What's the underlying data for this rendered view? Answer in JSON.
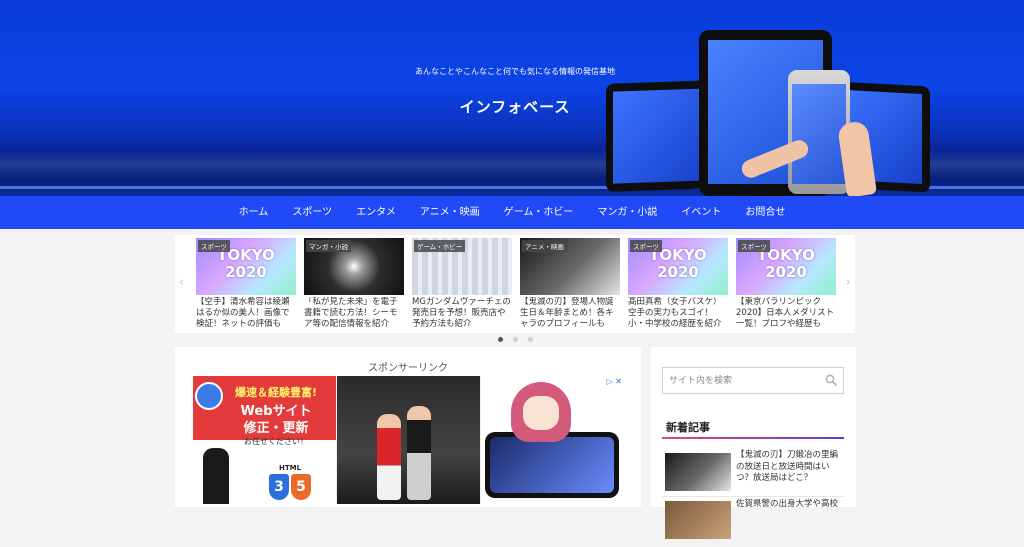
{
  "header": {
    "tagline": "あんなことやこんなこと何でも気になる情報の発信基地",
    "site_title": "インフォベース"
  },
  "nav": {
    "items": [
      "ホーム",
      "スポーツ",
      "エンタメ",
      "アニメ・映画",
      "ゲーム・ホビー",
      "マンガ・小説",
      "イベント",
      "お問合せ"
    ]
  },
  "carousel": {
    "prev_glyph": "‹",
    "next_glyph": "›",
    "cards": [
      {
        "category": "スポーツ",
        "thumb_text": "TOKYO\n2020",
        "title": "【空手】清水希容は綾瀬はるか似の美人！画像で検証！ネットの評価も"
      },
      {
        "category": "マンガ・小説",
        "title": "「私が見た未来」を電子書籍で読む方法！シーモア等の配信情報を紹介"
      },
      {
        "category": "ゲーム・ホビー",
        "title": "MGガンダムヴァーチェの発売日を予想！販売店や予約方法も紹介"
      },
      {
        "category": "アニメ・映画",
        "title": "【鬼滅の刃】登場人物誕生日＆年齢まとめ！各キャラのプロフィールも"
      },
      {
        "category": "スポーツ",
        "thumb_text": "TOKYO\n2020",
        "title": "髙田真希（女子バスケ）空手の実力もスゴイ！小・中学校の経歴を紹介"
      },
      {
        "category": "スポーツ",
        "thumb_text": "TOKYO\n2020",
        "title": "【東京パラリンピック2020】日本人メダリスト一覧！プロフや経歴も"
      }
    ],
    "dots": 3,
    "active_dot": 0
  },
  "main": {
    "sponsor_label": "スポンサーリンク",
    "ad": {
      "close_glyph": "▷ ✕",
      "panel1_line1": "爆速＆経験豊富!",
      "panel1_line2": "Webサイト",
      "panel1_line3": "修正・更新",
      "panel1_sub": "お任せください！",
      "panel1_html": "HTML",
      "panel1_css": "css",
      "panel1_badge_3": "3",
      "panel1_badge_5": "5"
    }
  },
  "sidebar": {
    "search_placeholder": "サイト内を検索",
    "new_posts_title": "新着記事",
    "posts": [
      {
        "title": "【鬼滅の刃】刀鍛冶の里編の放送日と放送時間はいつ？放送局はどこ？"
      },
      {
        "title": "佐賀県警の出身大学や高校"
      }
    ]
  },
  "colors": {
    "nav_bg": "#1f4af5",
    "header_blue": "#0c44e6",
    "accent_gradient_start": "#e34a6b",
    "accent_gradient_end": "#5c3ce8"
  }
}
